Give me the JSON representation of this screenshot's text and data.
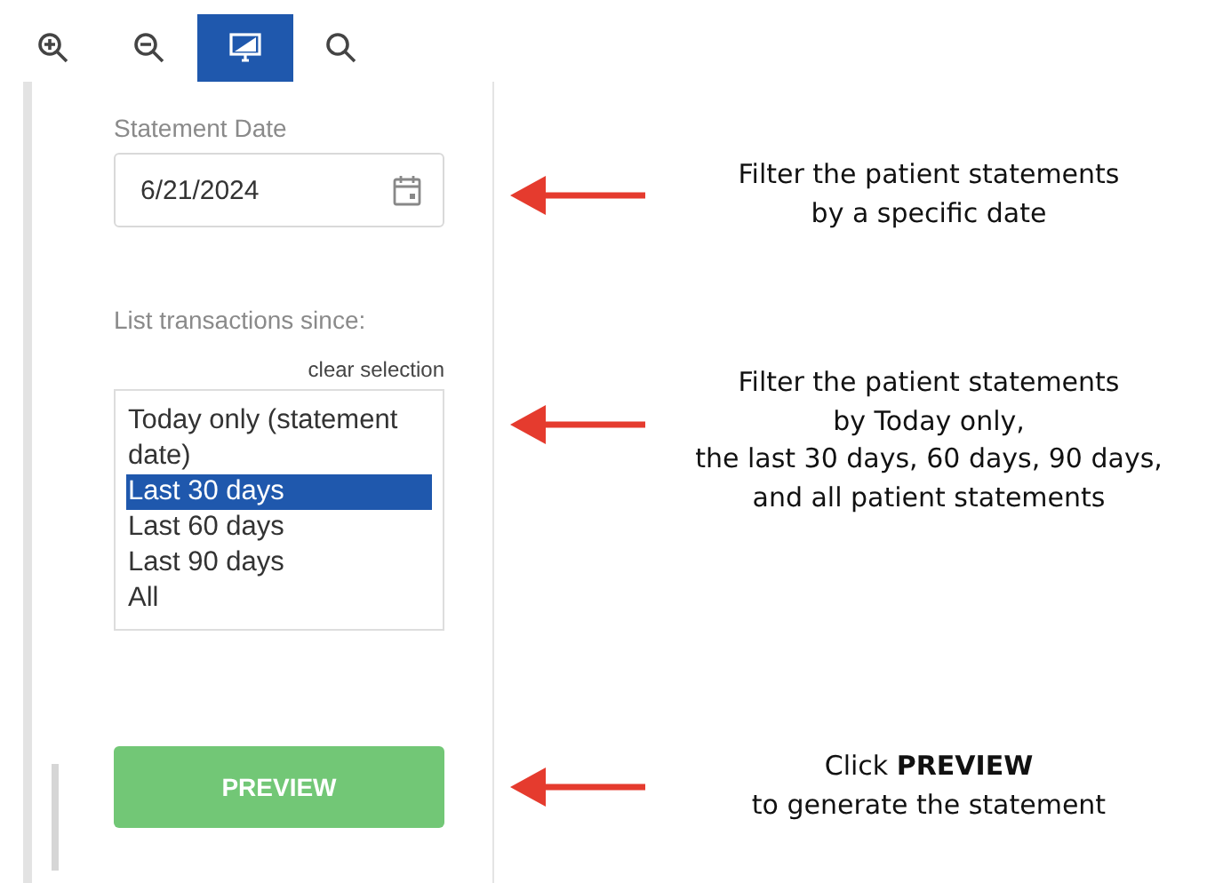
{
  "toolbar": [
    {
      "kind": "zoom-in",
      "selected": false
    },
    {
      "kind": "zoom-out",
      "selected": false
    },
    {
      "kind": "monitor",
      "selected": true
    },
    {
      "kind": "search",
      "selected": false
    }
  ],
  "form": {
    "date_label": "Statement Date",
    "date_value": "6/21/2024",
    "list_label": "List transactions since:",
    "clear_selection": "clear selection",
    "options": [
      {
        "label": "Today only (statement date)",
        "selected": false
      },
      {
        "label": "Last 30 days",
        "selected": true
      },
      {
        "label": "Last 60 days",
        "selected": false
      },
      {
        "label": "Last 90 days",
        "selected": false
      },
      {
        "label": "All",
        "selected": false
      }
    ],
    "button": "PREVIEW"
  },
  "annotations": [
    {
      "lines": [
        "Filter the patient statements",
        "by a specific date"
      ]
    },
    {
      "lines": [
        "Filter the patient statements",
        "by Today only,",
        "the last 30 days, 60 days, 90 days,",
        "and all patient statements"
      ]
    },
    {
      "lines": [
        "Click **PREVIEW**",
        "to generate the statement"
      ]
    }
  ]
}
